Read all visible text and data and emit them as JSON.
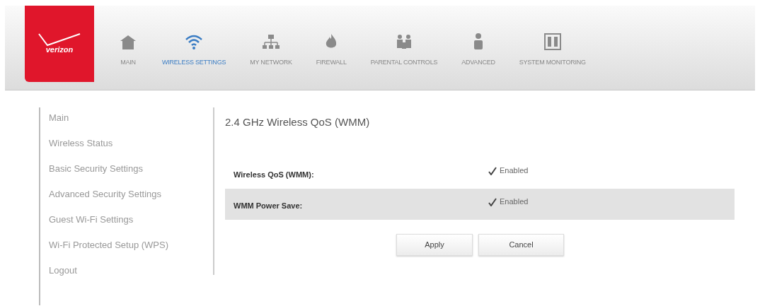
{
  "logo": {
    "text": "verizon"
  },
  "nav": [
    {
      "label": "MAIN",
      "selected": false
    },
    {
      "label": "WIRELESS SETTINGS",
      "selected": true
    },
    {
      "label": "MY NETWORK",
      "selected": false
    },
    {
      "label": "FIREWALL",
      "selected": false
    },
    {
      "label": "PARENTAL CONTROLS",
      "selected": false
    },
    {
      "label": "ADVANCED",
      "selected": false
    },
    {
      "label": "SYSTEM MONITORING",
      "selected": false
    }
  ],
  "sidebar": {
    "items": [
      {
        "label": "Main"
      },
      {
        "label": "Wireless Status"
      },
      {
        "label": "Basic Security Settings"
      },
      {
        "label": "Advanced Security Settings"
      },
      {
        "label": "Guest Wi-Fi Settings"
      },
      {
        "label": "Wi-Fi Protected Setup (WPS)"
      },
      {
        "label": "Logout"
      }
    ]
  },
  "content": {
    "title": "2.4 GHz Wireless QoS (WMM)",
    "rows": [
      {
        "label": "Wireless QoS (WMM):",
        "option": "Enabled",
        "checked": true
      },
      {
        "label": "WMM Power Save:",
        "option": "Enabled",
        "checked": true
      }
    ],
    "buttons": [
      "Apply",
      "Cancel"
    ]
  }
}
